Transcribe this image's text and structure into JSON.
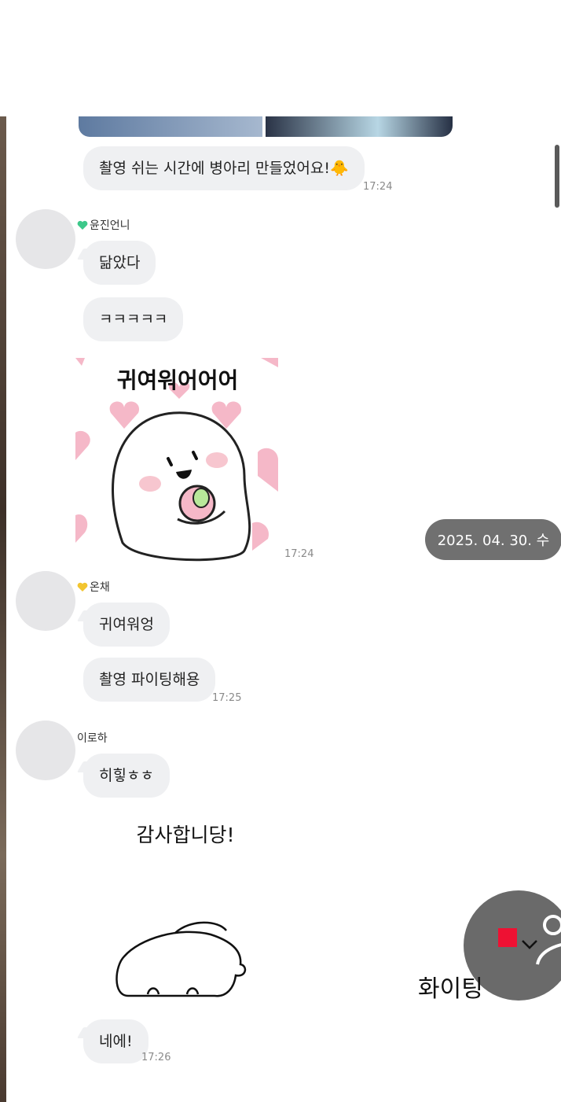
{
  "messages": {
    "m1_text": "촬영 쉬는 시간에 병아리 만들었어요!🐥",
    "m1_time": "17:24",
    "sender_yunjin": "윤진언니",
    "m2_text": "닮았다",
    "m3_text": "ㅋㅋㅋㅋㅋ",
    "sticker1_caption": "귀여워어어어",
    "sticker1_time": "17:24",
    "sender_onchae": "온채",
    "m4_text": "귀여워엉",
    "m5_text": "촬영 파이팅해용",
    "m5_time": "17:25",
    "sender_iroha": "이로하",
    "m6_text": "히힣ㅎㅎ",
    "sticker2_caption": "감사합니당!",
    "m7_text": "네에!",
    "m7_time": "17:26"
  },
  "date_divider": "2025. 04. 30. 수",
  "overlay": {
    "cut_text": "화이팅",
    "record_color": "#ee1133"
  },
  "colors": {
    "bubble_bg": "#eff0f2",
    "time_text": "#8a8a8a",
    "date_pill_bg": "#707070",
    "heart_green": "#3cc88a",
    "heart_yellow": "#f2c530",
    "sticker_pink": "#f5b8c8"
  },
  "icons": {
    "record": "record-stop-icon",
    "chevron": "chevron-down-icon",
    "person": "person-icon"
  }
}
